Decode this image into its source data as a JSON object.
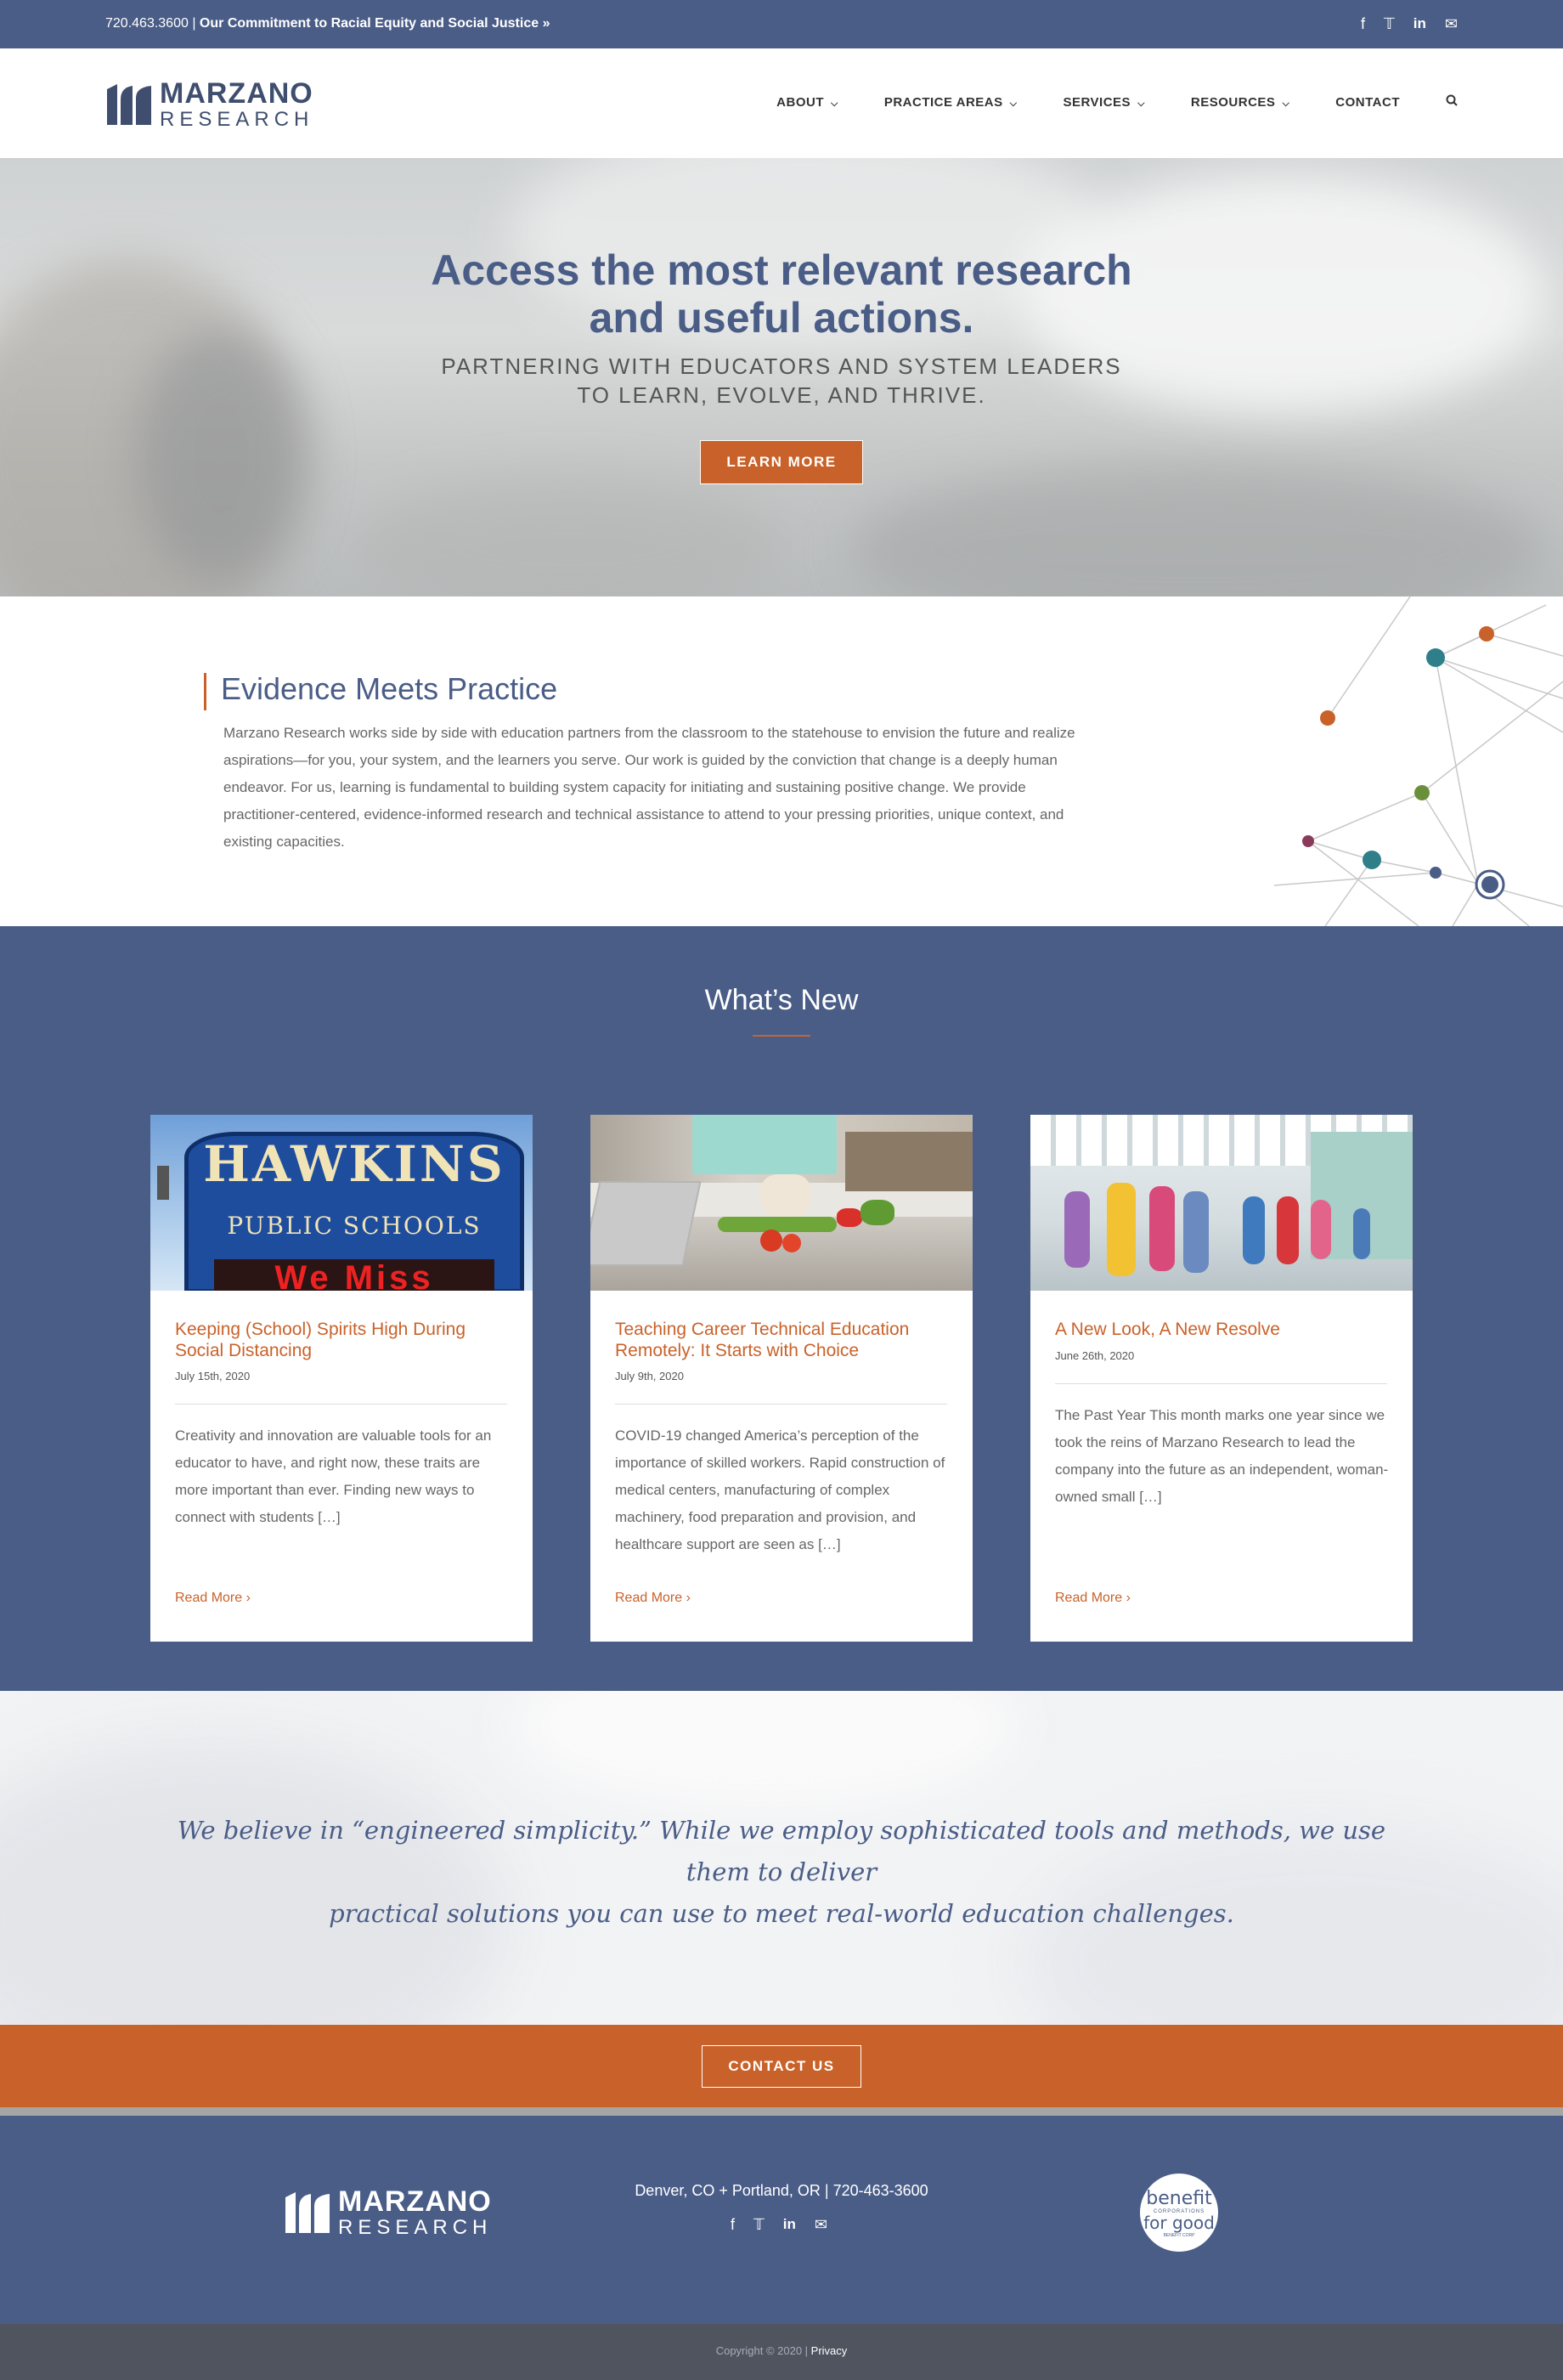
{
  "colors": {
    "brand_blue": "#4a5d87",
    "accent_orange": "#c9622a",
    "footer_dark": "#4f545f"
  },
  "topbar": {
    "phone": "720.463.3600",
    "separator": " | ",
    "commitment_link": "Our Commitment to Racial Equity and Social Justice »",
    "social_icons": [
      "facebook-icon",
      "twitter-icon",
      "linkedin-icon",
      "email-icon"
    ]
  },
  "header": {
    "logo": {
      "line1": "MARZANO",
      "line2": "RESEARCH"
    },
    "nav": [
      {
        "label": "ABOUT",
        "dropdown": true
      },
      {
        "label": "PRACTICE AREAS",
        "dropdown": true
      },
      {
        "label": "SERVICES",
        "dropdown": true
      },
      {
        "label": "RESOURCES",
        "dropdown": true
      },
      {
        "label": "CONTACT",
        "dropdown": false
      }
    ]
  },
  "hero": {
    "title_line1": "Access the most relevant research",
    "title_line2": "and useful actions.",
    "subtitle_line1": "PARTNERING WITH EDUCATORS AND SYSTEM LEADERS",
    "subtitle_line2": "TO LEARN, EVOLVE, AND THRIVE.",
    "button": "LEARN MORE"
  },
  "evidence": {
    "title": "Evidence Meets Practice",
    "body": "Marzano Research works side by side with education partners from the classroom to the statehouse to envision the future and realize aspirations—for you, your system, and the learners you serve. Our work is guided by the conviction that change is a deeply human endeavor. For us, learning is fundamental to building system capacity for initiating and sustaining positive change. We provide practitioner-centered, evidence-informed research and technical assistance to attend to your pressing priorities, unique context, and existing capacities."
  },
  "news": {
    "title": "What’s New",
    "cards": [
      {
        "title": "Keeping (School) Spirits High During Social Distancing",
        "date": "July 15th, 2020",
        "excerpt": "Creativity and innovation are valuable tools for an educator to have, and right now, these traits are more important than ever. Finding new ways to connect with students […]",
        "more": "Read More",
        "image": {
          "sign_name": "HAWKINS",
          "sign_sub": "PUBLIC SCHOOLS",
          "led": "We Miss"
        }
      },
      {
        "title": "Teaching Career Technical Education Remotely: It Starts with Choice",
        "date": "July 9th, 2020",
        "excerpt": "COVID-19 changed America’s perception of the importance of skilled workers. Rapid construction of medical centers, manufacturing of complex machinery, food preparation and provision, and healthcare support are seen as […]",
        "more": "Read More"
      },
      {
        "title": "A New Look, A New Resolve",
        "date": "June 26th, 2020",
        "excerpt": "The Past Year This month marks one year since we took the reins of Marzano Research to lead the company into the future as an independent, woman-owned small […]",
        "more": "Read More"
      }
    ]
  },
  "quote": {
    "line1": "We believe in “engineered simplicity.” While we employ sophisticated tools and methods, we use them to deliver",
    "line2": "practical solutions you can use to meet real-world education challenges."
  },
  "cta": {
    "button": "CONTACT US"
  },
  "footer": {
    "logo": {
      "line1": "MARZANO",
      "line2": "RESEARCH"
    },
    "address": "Denver, CO + Portland, OR | 720-463-3600",
    "social_icons": [
      "facebook-icon",
      "twitter-icon",
      "linkedin-icon",
      "email-icon"
    ],
    "bcorp": {
      "line1": "benefit",
      "line2": "CORPORATIONS",
      "line3": "for good",
      "line4": "BENEFIT CORP"
    },
    "copyright": "Copyright © 2020 | ",
    "privacy": "Privacy"
  }
}
